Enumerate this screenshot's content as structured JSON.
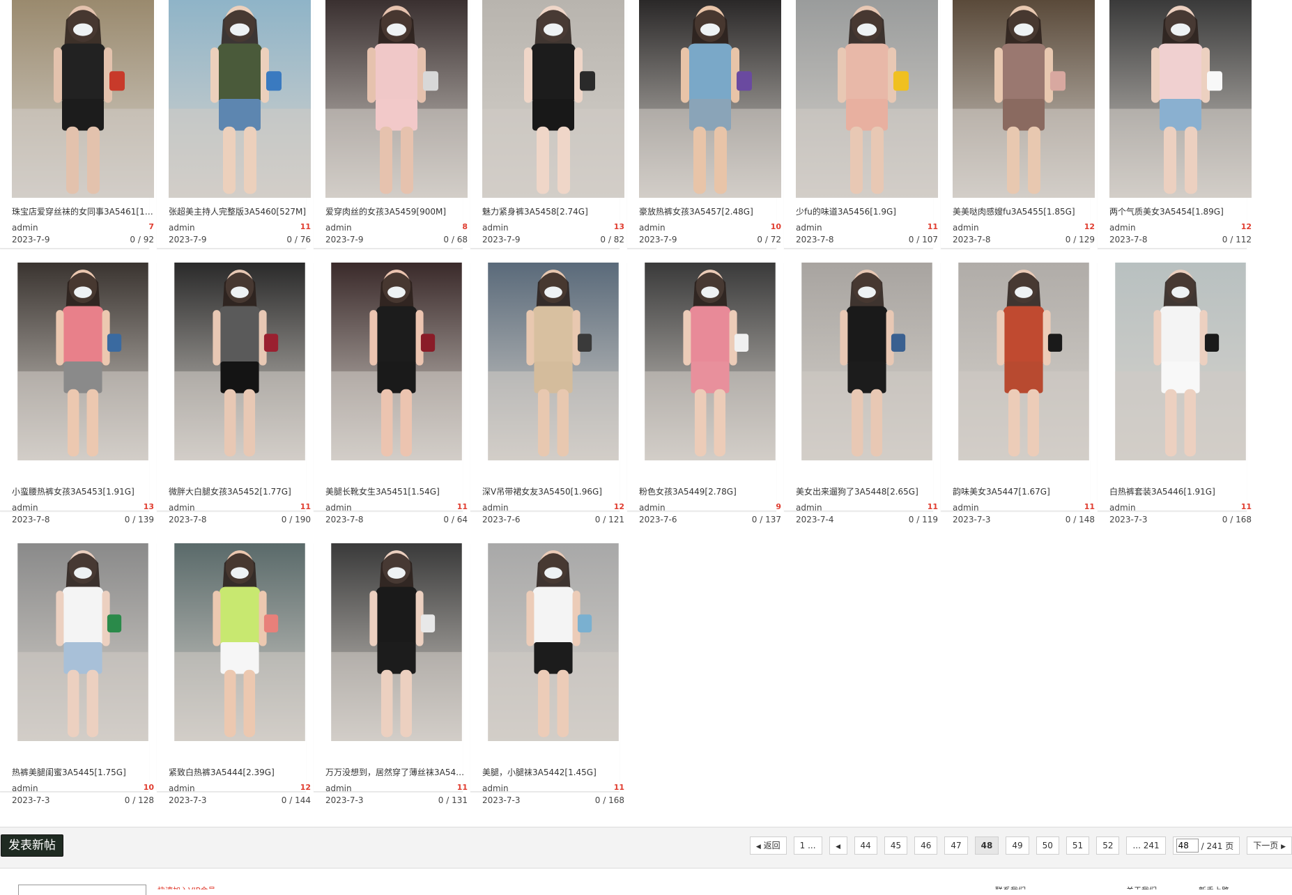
{
  "posts": [
    {
      "title": "珠宝店爱穿丝袜的女同事3A5461[10...",
      "author": "admin",
      "replies": "7",
      "date": "2023-7-9",
      "views": "0 / 92"
    },
    {
      "title": "张超美主持人完整版3A5460[527M]",
      "author": "admin",
      "replies": "11",
      "date": "2023-7-9",
      "views": "0 / 76"
    },
    {
      "title": "爱穿肉丝的女孩3A5459[900M]",
      "author": "admin",
      "replies": "8",
      "date": "2023-7-9",
      "views": "0 / 68"
    },
    {
      "title": "魅力紧身裤3A5458[2.74G]",
      "author": "admin",
      "replies": "13",
      "date": "2023-7-9",
      "views": "0 / 82"
    },
    {
      "title": "豪放热裤女孩3A5457[2.48G]",
      "author": "admin",
      "replies": "10",
      "date": "2023-7-9",
      "views": "0 / 72"
    },
    {
      "title": "少fu的味道3A5456[1.9G]",
      "author": "admin",
      "replies": "11",
      "date": "2023-7-8",
      "views": "0 / 107"
    },
    {
      "title": "美美哒肉感嫂fu3A5455[1.85G]",
      "author": "admin",
      "replies": "12",
      "date": "2023-7-8",
      "views": "0 / 129"
    },
    {
      "title": "两个气质美女3A5454[1.89G]",
      "author": "admin",
      "replies": "12",
      "date": "2023-7-8",
      "views": "0 / 112"
    },
    {
      "title": "小蛮腰热裤女孩3A5453[1.91G]",
      "author": "admin",
      "replies": "13",
      "date": "2023-7-8",
      "views": "0 / 139"
    },
    {
      "title": "微胖大白腿女孩3A5452[1.77G]",
      "author": "admin",
      "replies": "11",
      "date": "2023-7-8",
      "views": "0 / 190"
    },
    {
      "title": "美腿长靴女生3A5451[1.54G]",
      "author": "admin",
      "replies": "11",
      "date": "2023-7-8",
      "views": "0 / 64"
    },
    {
      "title": "深V吊带裙女友3A5450[1.96G]",
      "author": "admin",
      "replies": "12",
      "date": "2023-7-6",
      "views": "0 / 121"
    },
    {
      "title": "粉色女孩3A5449[2.78G]",
      "author": "admin",
      "replies": "9",
      "date": "2023-7-6",
      "views": "0 / 137"
    },
    {
      "title": "美女出来遛狗了3A5448[2.65G]",
      "author": "admin",
      "replies": "11",
      "date": "2023-7-4",
      "views": "0 / 119"
    },
    {
      "title": "韵味美女3A5447[1.67G]",
      "author": "admin",
      "replies": "11",
      "date": "2023-7-3",
      "views": "0 / 148"
    },
    {
      "title": "白热裤套装3A5446[1.91G]",
      "author": "admin",
      "replies": "11",
      "date": "2023-7-3",
      "views": "0 / 168"
    },
    {
      "title": "热裤美腿闺蜜3A5445[1.75G]",
      "author": "admin",
      "replies": "10",
      "date": "2023-7-3",
      "views": "0 / 128"
    },
    {
      "title": "紧致白热裤3A5444[2.39G]",
      "author": "admin",
      "replies": "12",
      "date": "2023-7-3",
      "views": "0 / 144"
    },
    {
      "title": "万万没想到，居然穿了薄丝袜3A544...",
      "author": "admin",
      "replies": "11",
      "date": "2023-7-3",
      "views": "0 / 131"
    },
    {
      "title": "美腿，小腿袜3A5442[1.45G]",
      "author": "admin",
      "replies": "11",
      "date": "2023-7-3",
      "views": "0 / 168"
    }
  ],
  "thumb_palette": [
    {
      "bg": "#9a8a6e",
      "top": "#222222",
      "bottom": "#1c1c1c",
      "skin": "#e3c2ad",
      "accent": "#c83a2a"
    },
    {
      "bg": "#8fb4c8",
      "top": "#4a5a3a",
      "bottom": "#5d86b0",
      "skin": "#ecd0bc",
      "accent": "#3a7ac0"
    },
    {
      "bg": "#3a3030",
      "top": "#f0c8c8",
      "bottom": "#f2c9c9",
      "skin": "#e6c2ae",
      "accent": "#d8d8d8"
    },
    {
      "bg": "#b8b4ae",
      "top": "#1c1c1c",
      "bottom": "#181818",
      "skin": "#efd6c8",
      "accent": "#2a2a2a"
    },
    {
      "bg": "#2a2828",
      "top": "#7aa8c8",
      "bottom": "#8aa4b8",
      "skin": "#e8c4a8",
      "accent": "#6a4aa0"
    },
    {
      "bg": "#9a9c9c",
      "top": "#e8b8a8",
      "bottom": "#e8b0a0",
      "skin": "#e8c8b4",
      "accent": "#f0c020"
    },
    {
      "bg": "#5a4a3a",
      "top": "#9a7870",
      "bottom": "#8a6a60",
      "skin": "#e8c8b0",
      "accent": "#d8a8a0"
    },
    {
      "bg": "#3a3a3a",
      "top": "#f0d0d0",
      "bottom": "#8ab0d0",
      "skin": "#ecd0c0",
      "accent": "#f8f8f8"
    },
    {
      "bg": "#3a3430",
      "top": "#e8808a",
      "bottom": "#8a8a8a",
      "skin": "#ecc8b0",
      "accent": "#3a6aa0"
    },
    {
      "bg": "#2a2a2a",
      "top": "#5a5a5a",
      "bottom": "#141414",
      "skin": "#e8c8b4",
      "accent": "#9a2030"
    },
    {
      "bg": "#3a2a2a",
      "top": "#1c1c1c",
      "bottom": "#1a1a1a",
      "skin": "#ecc4b0",
      "accent": "#8a1c28"
    },
    {
      "bg": "#5a6a7a",
      "top": "#d8c0a0",
      "bottom": "#d4bc9c",
      "skin": "#e8c8b0",
      "accent": "#3a3a3a"
    },
    {
      "bg": "#3a3a3a",
      "top": "#e88a98",
      "bottom": "#e8909c",
      "skin": "#ecccb8",
      "accent": "#f0f0f0"
    },
    {
      "bg": "#a8a4a0",
      "top": "#1a1a1a",
      "bottom": "#1c1c1c",
      "skin": "#e8c8b4",
      "accent": "#3a6090"
    },
    {
      "bg": "#b0aca8",
      "top": "#c04a30",
      "bottom": "#b84a30",
      "skin": "#ecccb8",
      "accent": "#1a1a1a"
    },
    {
      "bg": "#b8c0c0",
      "top": "#f4f4f4",
      "bottom": "#f8f8f8",
      "skin": "#ecd0c0",
      "accent": "#1a1a1a"
    },
    {
      "bg": "#8a8a8a",
      "top": "#f4f4f4",
      "bottom": "#a8c0d8",
      "skin": "#ecd0c0",
      "accent": "#2a8a4a"
    },
    {
      "bg": "#5a6a6a",
      "top": "#c8e870",
      "bottom": "#f6f6f6",
      "skin": "#ecc8b0",
      "accent": "#e8807a"
    },
    {
      "bg": "#3a3a3a",
      "top": "#1a1a1a",
      "bottom": "#1c1c1c",
      "skin": "#ecd0c0",
      "accent": "#e8e8e8"
    },
    {
      "bg": "#a8a8a8",
      "top": "#f4f4f4",
      "bottom": "#1c1c1c",
      "skin": "#ecccb8",
      "accent": "#7ab0d0"
    }
  ],
  "bottom_bar": {
    "new_post": "发表新帖",
    "back": "返回",
    "first_page": "1 ...",
    "pages": [
      "44",
      "45",
      "46",
      "47",
      "48",
      "49",
      "50",
      "51",
      "52"
    ],
    "current_page": "48",
    "last_page": "... 241",
    "page_input": "48",
    "total_pages": "/ 241 页",
    "next": "下一页"
  },
  "footer": {
    "text_left": "快速加入VIP会员",
    "text_mid": "联系我们",
    "text_r1": "关于我们",
    "text_r2": "新手上路"
  },
  "icons": {
    "prev": "triangle-left-icon",
    "next": "triangle-right-icon",
    "back": "triangle-left-icon"
  }
}
